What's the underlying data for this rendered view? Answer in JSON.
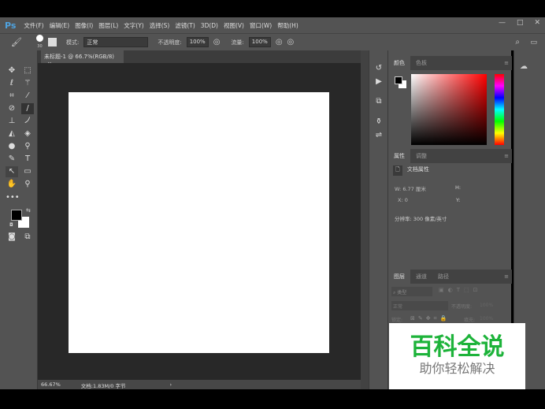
{
  "app": {
    "logo": "Ps"
  },
  "menu": [
    "文件(F)",
    "编辑(E)",
    "图像(I)",
    "图层(L)",
    "文字(Y)",
    "选择(S)",
    "滤镜(T)",
    "3D(D)",
    "视图(V)",
    "窗口(W)",
    "帮助(H)"
  ],
  "window_controls": [
    "—",
    "□",
    "✕"
  ],
  "options": {
    "brush_size": "30",
    "mode_label": "模式:",
    "mode_value": "正常",
    "opacity_label": "不透明度:",
    "opacity_value": "100%",
    "flow_label": "流量:",
    "flow_value": "100%"
  },
  "document": {
    "tab_title": "未标题-1 @ 66.7%(RGB/8)",
    "close": "×",
    "zoom": "66.67%",
    "doc_info": "文档:1.83M/0 字节",
    "arrow": "›"
  },
  "color_panel": {
    "tabs": [
      "颜色",
      "色板"
    ]
  },
  "properties_panel": {
    "tabs": [
      "属性",
      "调整"
    ],
    "title": "文档属性",
    "w_label": "W:",
    "w_value": "6.77 厘米",
    "h_label": "H:",
    "x_label": "X:",
    "x_value": "0",
    "y_label": "Y:",
    "resolution": "分辨率: 300 像素/英寸"
  },
  "layers_panel": {
    "tabs": [
      "图层",
      "通道",
      "路径"
    ],
    "filter": "类型",
    "blend": "正常",
    "opacity_label": "不透明度:",
    "opacity_value": "100%",
    "lock_label": "锁定:",
    "fill_label": "填充:",
    "fill_value": "100%"
  },
  "watermark": {
    "title": "百科全说",
    "subtitle": "助你轻松解决"
  }
}
